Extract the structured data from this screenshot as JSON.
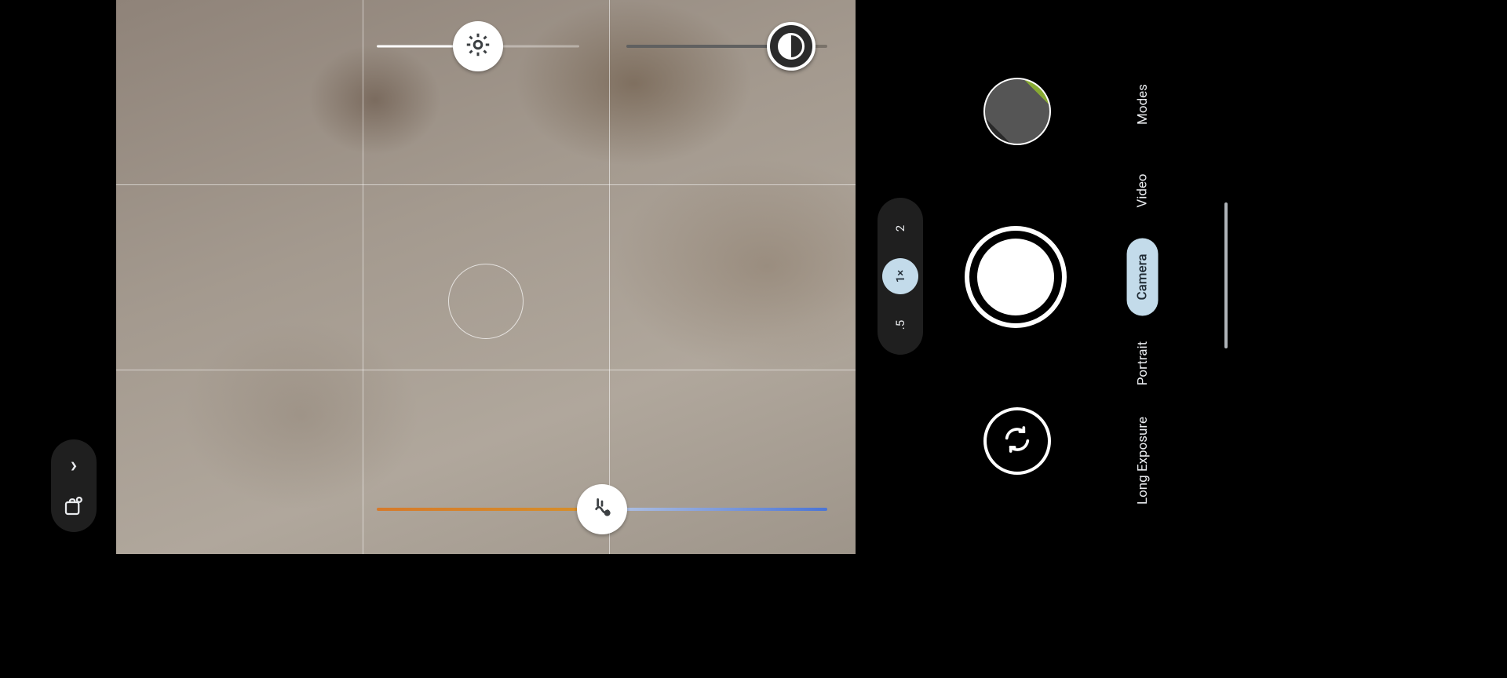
{
  "modes": {
    "items": [
      "Modes",
      "Video",
      "Camera",
      "Portrait",
      "Long Exposure"
    ],
    "active_index": 2
  },
  "zoom": {
    "levels": [
      "2",
      "1×",
      ".5"
    ],
    "active_index": 1
  },
  "sliders": {
    "brightness": {
      "position_pct": 50
    },
    "shadows": {
      "position_pct": 82
    },
    "white_balance": {
      "position_pct": 50
    }
  },
  "icons": {
    "brightness": "brightness-icon",
    "shadows": "shadows-icon",
    "white_balance": "white-balance-icon",
    "expand": "chevron-right-icon",
    "settings": "settings-effects-icon",
    "flip": "camera-flip-icon",
    "gallery": "gallery-thumbnail"
  }
}
